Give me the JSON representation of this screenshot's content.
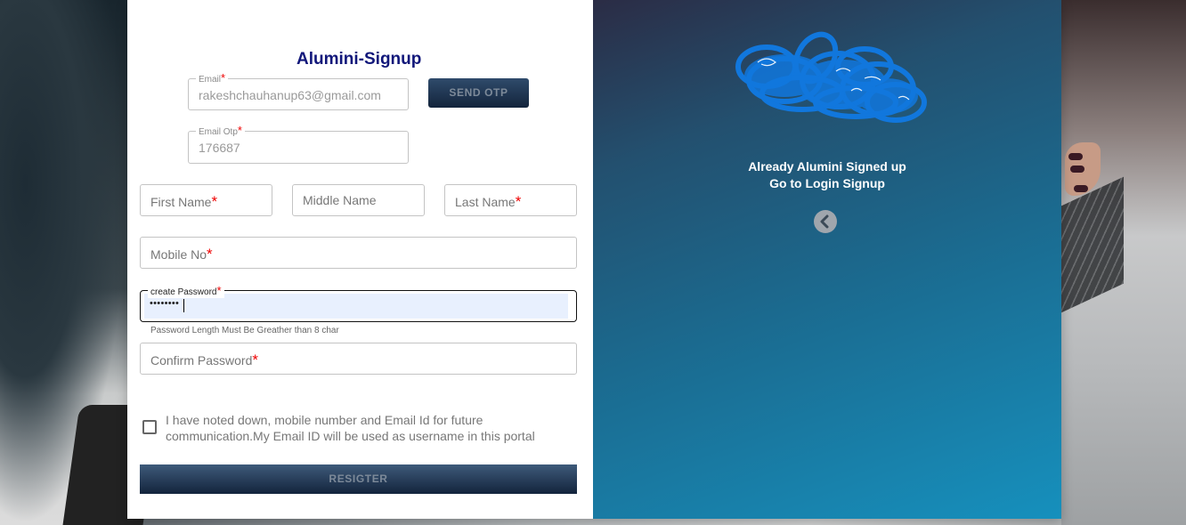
{
  "form": {
    "title": "Alumini-Signup",
    "email": {
      "label": "Email",
      "required": "*",
      "value": "rakeshchauhanup63@gmail.com"
    },
    "send_otp": "SEND OTP",
    "email_otp": {
      "label": "Email Otp",
      "required": "*",
      "value": "176687"
    },
    "first_name": {
      "placeholder": "First Name",
      "required": "*"
    },
    "middle_name": {
      "placeholder": "Middle Name"
    },
    "last_name": {
      "placeholder": "Last Name",
      "required": "*"
    },
    "mobile": {
      "placeholder": "Mobile No",
      "required": "*"
    },
    "create_password": {
      "label": "create Password",
      "required": "*",
      "value": "••••••••"
    },
    "password_helper": "Password Length Must Be Greather than 8 char",
    "confirm_password": {
      "placeholder": "Confirm Password",
      "required": "*"
    },
    "agree_text": "I have noted down, mobile number and Email Id for future communication.My Email ID will be used as username in this portal",
    "agree_checked": false,
    "register": "RESIGTER"
  },
  "info": {
    "line1": "Already Alumini Signed up",
    "line2": "Go to Login Signup",
    "back_icon": "chevron-left-icon",
    "logo_icon": "scribbled-logo-icon"
  },
  "colors": {
    "title": "#11177a",
    "button_top": "#2f4b6b",
    "button_bottom": "#13243c",
    "required": "#ee0000",
    "panel_start": "#2b2c45",
    "panel_end": "#1690bd"
  }
}
